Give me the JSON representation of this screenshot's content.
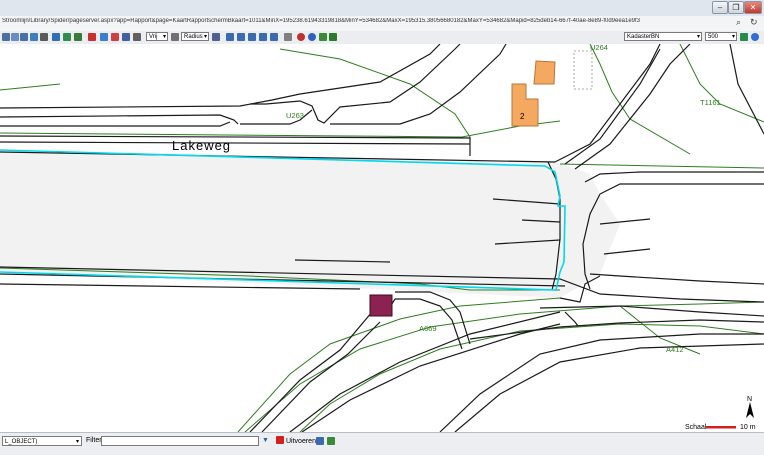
{
  "browser": {
    "url": "Stroomlijn/Library/Spider/pageserver.aspx?app=Rapport&page=KaartRapportschermBkaart=1011&MinX=195238.61943319818&MinY=534682&MaxX=195315.38056680182&MaxY=534682&Mapid=825deb14-667f-40ae-8e89-f0d9eea1e9f3",
    "search_icon": "search-icon",
    "refresh_icon": "refresh-icon"
  },
  "toolbar": {
    "select_mode": "Vrij",
    "radius_mode": "Radius",
    "layer_select": "KadasterBN",
    "scale_select": "500"
  },
  "map": {
    "street_label": "Lakeweg",
    "parcels": [
      "U264",
      "U263",
      "T1161",
      "A669",
      "A412"
    ],
    "building_label": "2",
    "colors": {
      "road_outline": "#1a1a1a",
      "parcel_line": "#2e7d1f",
      "selection": "#00d8ef",
      "building": "#f5a860",
      "marker": "#8b2252",
      "road_fill": "#f2f2f2"
    },
    "scale_label": "Schaal",
    "scale_value": "10 m",
    "north": "N"
  },
  "status": {
    "object_select": "L_OBJECT)",
    "filter_label": "Filter",
    "filter_value": "",
    "run_label": "Uitvoeren"
  }
}
